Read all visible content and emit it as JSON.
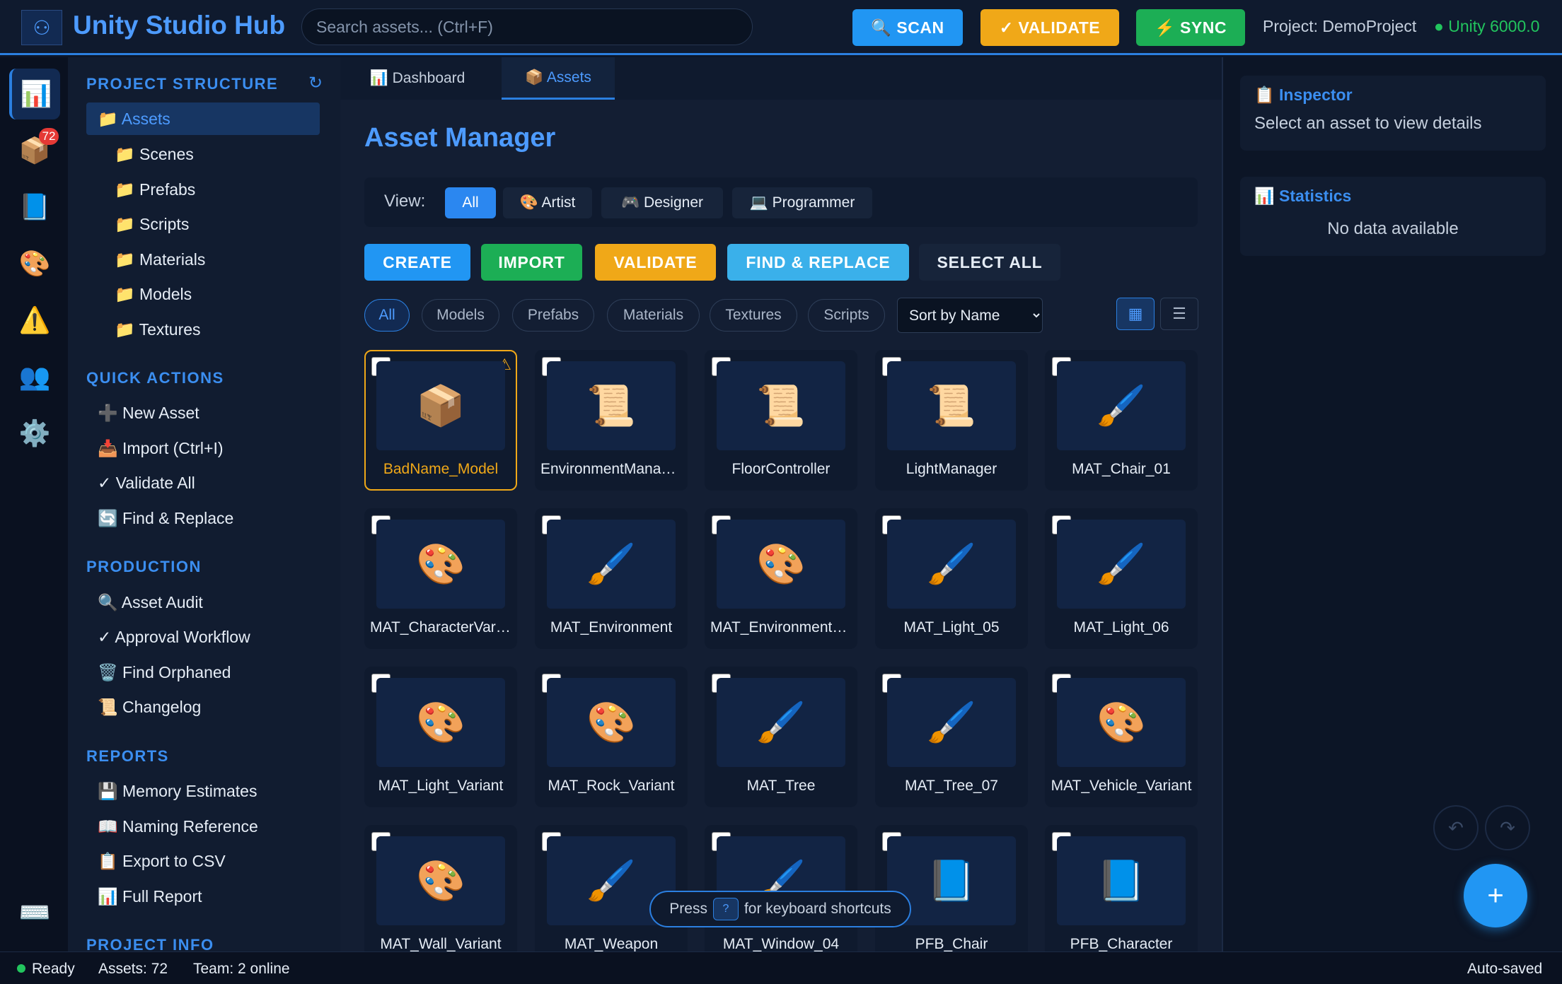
{
  "app": {
    "logo_icon": "unity-logo-icon",
    "title": "Unity Studio Hub",
    "search_placeholder": "Search assets... (Ctrl+F)",
    "buttons": {
      "scan": "🔍 SCAN",
      "validate": "✓ VALIDATE",
      "sync": "⚡ SYNC"
    },
    "project": "Project: DemoProject",
    "unity_version": "● Unity 6000.0"
  },
  "rail": {
    "items": [
      {
        "icon": "📊",
        "name": "dashboard-icon"
      },
      {
        "icon": "📦",
        "name": "assets-icon",
        "badge": "72"
      },
      {
        "icon": "📘",
        "name": "docs-icon"
      },
      {
        "icon": "🎨",
        "name": "palette-icon"
      },
      {
        "icon": "⚠️",
        "name": "warning-icon"
      },
      {
        "icon": "👥",
        "name": "team-icon"
      },
      {
        "icon": "⚙️",
        "name": "settings-icon"
      },
      {
        "icon": "⌨️",
        "name": "keyboard-icon"
      }
    ]
  },
  "sidebar": {
    "structure_title": "PROJECT STRUCTURE",
    "refresh_icon": "↻",
    "structure": [
      "📁 Assets",
      "📁 Scenes",
      "📁 Prefabs",
      "📁 Scripts",
      "📁 Materials",
      "📁 Models",
      "📁 Textures"
    ],
    "quick_title": "QUICK ACTIONS",
    "quick": [
      "➕ New Asset",
      "📥 Import (Ctrl+I)",
      "✓ Validate All",
      "🔄 Find & Replace"
    ],
    "production_title": "PRODUCTION",
    "production": [
      "🔍 Asset Audit",
      "✓ Approval Workflow",
      "🗑️ Find Orphaned",
      "📜 Changelog"
    ],
    "reports_title": "REPORTS",
    "reports": [
      "💾 Memory Estimates",
      "📖 Naming Reference",
      "📋 Export to CSV",
      "📊 Full Report"
    ],
    "info_title": "PROJECT INFO"
  },
  "main": {
    "tabs": [
      "📊 Dashboard",
      "📦 Assets"
    ],
    "title": "Asset Manager",
    "view_label": "View:",
    "views": [
      "All",
      "🎨 Artist",
      "🎮 Designer",
      "💻 Programmer"
    ],
    "actions": {
      "create": "CREATE",
      "import": "IMPORT",
      "validate": "VALIDATE",
      "find": "FIND & REPLACE",
      "select_all": "SELECT ALL"
    },
    "filters": [
      "All",
      "Models",
      "Prefabs",
      "Materials",
      "Textures",
      "Scripts"
    ],
    "sort": "Sort by Name",
    "layout": {
      "grid": "▦",
      "list": "☰"
    },
    "assets": [
      {
        "name": "BadName_Model",
        "icon": "📦",
        "warning": "⚠"
      },
      {
        "name": "EnvironmentManager",
        "icon": "📜"
      },
      {
        "name": "FloorController",
        "icon": "📜"
      },
      {
        "name": "LightManager",
        "icon": "📜"
      },
      {
        "name": "MAT_Chair_01",
        "icon": "🖌️"
      },
      {
        "name": "MAT_CharacterVariant",
        "icon": "🎨"
      },
      {
        "name": "MAT_Environment",
        "icon": "🖌️"
      },
      {
        "name": "MAT_EnvironmentVariant",
        "icon": "🎨"
      },
      {
        "name": "MAT_Light_05",
        "icon": "🖌️"
      },
      {
        "name": "MAT_Light_06",
        "icon": "🖌️"
      },
      {
        "name": "MAT_Light_Variant",
        "icon": "🎨"
      },
      {
        "name": "MAT_Rock_Variant",
        "icon": "🎨"
      },
      {
        "name": "MAT_Tree",
        "icon": "🖌️"
      },
      {
        "name": "MAT_Tree_07",
        "icon": "🖌️"
      },
      {
        "name": "MAT_Vehicle_Variant",
        "icon": "🎨"
      },
      {
        "name": "MAT_Wall_Variant",
        "icon": "🎨"
      },
      {
        "name": "MAT_Weapon",
        "icon": "🖌️"
      },
      {
        "name": "MAT_Window_04",
        "icon": "🖌️"
      },
      {
        "name": "PFB_Chair",
        "icon": "📘"
      },
      {
        "name": "PFB_Character",
        "icon": "📘"
      }
    ],
    "hint_prefix": "Press",
    "hint_key": "?",
    "hint_suffix": "for keyboard shortcuts"
  },
  "right": {
    "inspector_title": "📋 Inspector",
    "inspector_body": "Select an asset to view details",
    "stats_title": "📊 Statistics",
    "stats_body": "No data available",
    "undo": "↶",
    "redo": "↷",
    "fab": "+"
  },
  "status": {
    "ready": "Ready",
    "assets": "Assets: 72",
    "team": "Team: 2 online",
    "saved": "Auto-saved"
  }
}
